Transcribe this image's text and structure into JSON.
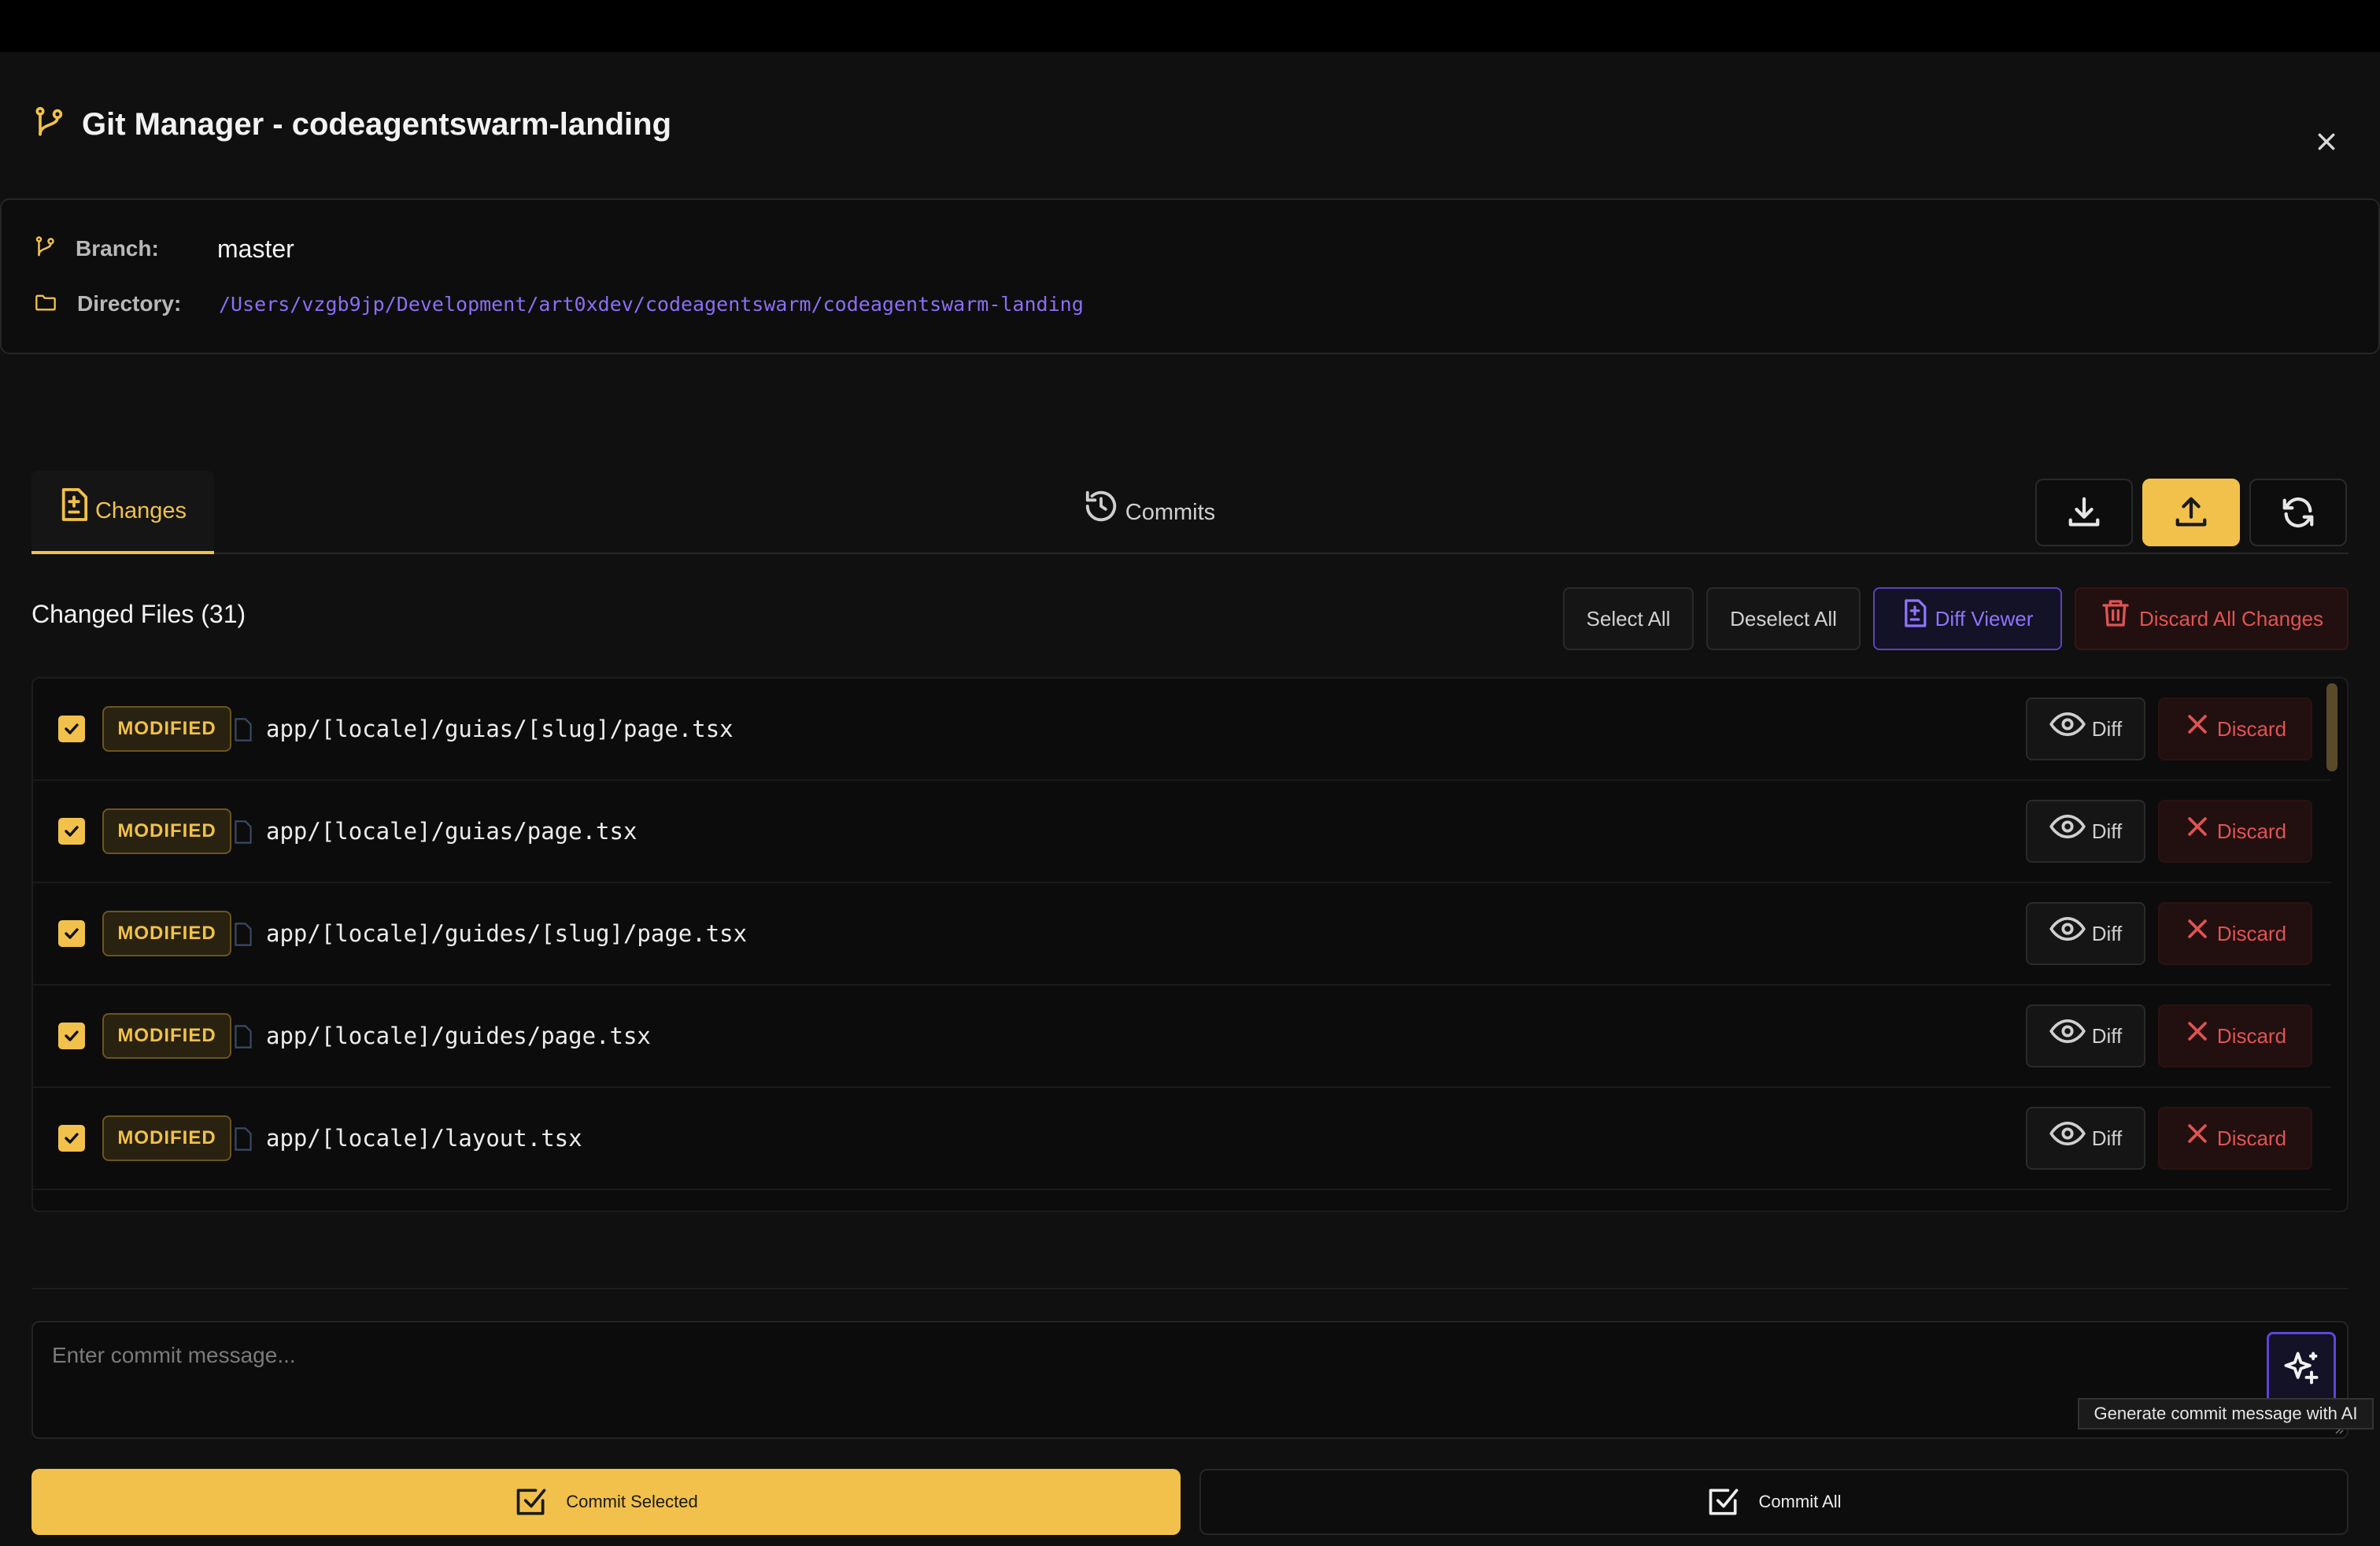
{
  "window": {
    "title": "Git Manager - codeagentswarm-landing"
  },
  "info": {
    "branch_label": "Branch:",
    "branch_value": "master",
    "directory_label": "Directory:",
    "directory_value": "/Users/vzgb9jp/Development/art0xdev/codeagentswarm/codeagentswarm-landing"
  },
  "tabs": {
    "changes": "Changes",
    "commits": "Commits"
  },
  "toolbar": {
    "pull_icon": "download-icon",
    "push_icon": "upload-icon",
    "refresh_icon": "refresh-icon"
  },
  "changed_files": {
    "title": "Changed Files (31)",
    "select_all": "Select All",
    "deselect_all": "Deselect All",
    "diff_viewer": "Diff Viewer",
    "discard_all": "Discard All Changes",
    "files": [
      {
        "status": "MODIFIED",
        "path": "app/[locale]/guias/[slug]/page.tsx",
        "diff": "Diff",
        "discard": "Discard"
      },
      {
        "status": "MODIFIED",
        "path": "app/[locale]/guias/page.tsx",
        "diff": "Diff",
        "discard": "Discard"
      },
      {
        "status": "MODIFIED",
        "path": "app/[locale]/guides/[slug]/page.tsx",
        "diff": "Diff",
        "discard": "Discard"
      },
      {
        "status": "MODIFIED",
        "path": "app/[locale]/guides/page.tsx",
        "diff": "Diff",
        "discard": "Discard"
      },
      {
        "status": "MODIFIED",
        "path": "app/[locale]/layout.tsx",
        "diff": "Diff",
        "discard": "Discard"
      }
    ]
  },
  "commit": {
    "placeholder": "Enter commit message...",
    "ai_tooltip": "Generate commit message with AI",
    "commit_selected": "Commit Selected",
    "commit_all": "Commit All"
  },
  "colors": {
    "accent": "#f2c14b",
    "purple": "#8f74ff",
    "danger": "#e05353",
    "background": "#101010"
  }
}
